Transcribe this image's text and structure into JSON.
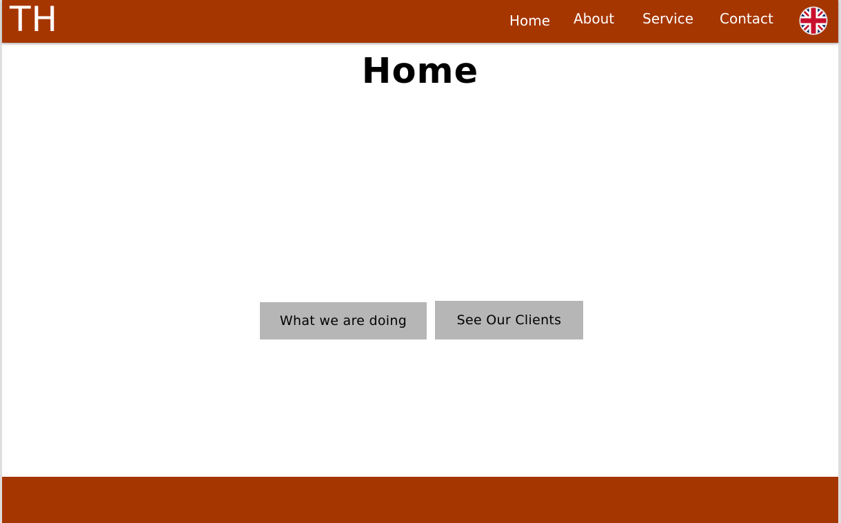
{
  "brand": {
    "logo_text": "TH",
    "color": "#a63600"
  },
  "nav": {
    "items": [
      {
        "label": "Home",
        "active": true
      },
      {
        "label": "About",
        "active": false
      },
      {
        "label": "Service",
        "active": false
      },
      {
        "label": "Contact",
        "active": false
      }
    ],
    "language_icon": "uk-flag-icon"
  },
  "main": {
    "title": "Home",
    "buttons": [
      {
        "label": "What we are doing",
        "color": "#b6b6b6"
      },
      {
        "label": "See Our Clients",
        "color": "#b6b6b6"
      }
    ]
  },
  "footer": {
    "color": "#a63600"
  }
}
